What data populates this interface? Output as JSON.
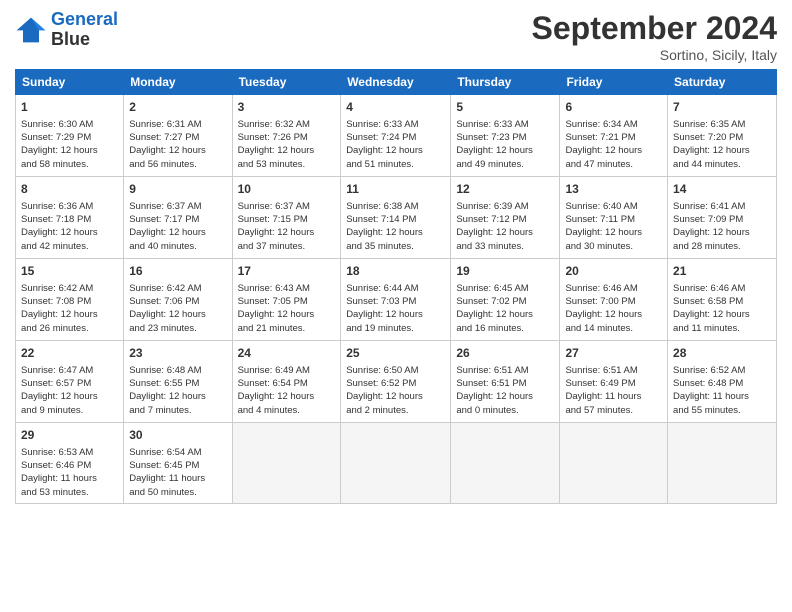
{
  "logo": {
    "line1": "General",
    "line2": "Blue"
  },
  "title": "September 2024",
  "location": "Sortino, Sicily, Italy",
  "days_of_week": [
    "Sunday",
    "Monday",
    "Tuesday",
    "Wednesday",
    "Thursday",
    "Friday",
    "Saturday"
  ],
  "weeks": [
    [
      {
        "num": "1",
        "info": "Sunrise: 6:30 AM\nSunset: 7:29 PM\nDaylight: 12 hours\nand 58 minutes."
      },
      {
        "num": "2",
        "info": "Sunrise: 6:31 AM\nSunset: 7:27 PM\nDaylight: 12 hours\nand 56 minutes."
      },
      {
        "num": "3",
        "info": "Sunrise: 6:32 AM\nSunset: 7:26 PM\nDaylight: 12 hours\nand 53 minutes."
      },
      {
        "num": "4",
        "info": "Sunrise: 6:33 AM\nSunset: 7:24 PM\nDaylight: 12 hours\nand 51 minutes."
      },
      {
        "num": "5",
        "info": "Sunrise: 6:33 AM\nSunset: 7:23 PM\nDaylight: 12 hours\nand 49 minutes."
      },
      {
        "num": "6",
        "info": "Sunrise: 6:34 AM\nSunset: 7:21 PM\nDaylight: 12 hours\nand 47 minutes."
      },
      {
        "num": "7",
        "info": "Sunrise: 6:35 AM\nSunset: 7:20 PM\nDaylight: 12 hours\nand 44 minutes."
      }
    ],
    [
      {
        "num": "8",
        "info": "Sunrise: 6:36 AM\nSunset: 7:18 PM\nDaylight: 12 hours\nand 42 minutes."
      },
      {
        "num": "9",
        "info": "Sunrise: 6:37 AM\nSunset: 7:17 PM\nDaylight: 12 hours\nand 40 minutes."
      },
      {
        "num": "10",
        "info": "Sunrise: 6:37 AM\nSunset: 7:15 PM\nDaylight: 12 hours\nand 37 minutes."
      },
      {
        "num": "11",
        "info": "Sunrise: 6:38 AM\nSunset: 7:14 PM\nDaylight: 12 hours\nand 35 minutes."
      },
      {
        "num": "12",
        "info": "Sunrise: 6:39 AM\nSunset: 7:12 PM\nDaylight: 12 hours\nand 33 minutes."
      },
      {
        "num": "13",
        "info": "Sunrise: 6:40 AM\nSunset: 7:11 PM\nDaylight: 12 hours\nand 30 minutes."
      },
      {
        "num": "14",
        "info": "Sunrise: 6:41 AM\nSunset: 7:09 PM\nDaylight: 12 hours\nand 28 minutes."
      }
    ],
    [
      {
        "num": "15",
        "info": "Sunrise: 6:42 AM\nSunset: 7:08 PM\nDaylight: 12 hours\nand 26 minutes."
      },
      {
        "num": "16",
        "info": "Sunrise: 6:42 AM\nSunset: 7:06 PM\nDaylight: 12 hours\nand 23 minutes."
      },
      {
        "num": "17",
        "info": "Sunrise: 6:43 AM\nSunset: 7:05 PM\nDaylight: 12 hours\nand 21 minutes."
      },
      {
        "num": "18",
        "info": "Sunrise: 6:44 AM\nSunset: 7:03 PM\nDaylight: 12 hours\nand 19 minutes."
      },
      {
        "num": "19",
        "info": "Sunrise: 6:45 AM\nSunset: 7:02 PM\nDaylight: 12 hours\nand 16 minutes."
      },
      {
        "num": "20",
        "info": "Sunrise: 6:46 AM\nSunset: 7:00 PM\nDaylight: 12 hours\nand 14 minutes."
      },
      {
        "num": "21",
        "info": "Sunrise: 6:46 AM\nSunset: 6:58 PM\nDaylight: 12 hours\nand 11 minutes."
      }
    ],
    [
      {
        "num": "22",
        "info": "Sunrise: 6:47 AM\nSunset: 6:57 PM\nDaylight: 12 hours\nand 9 minutes."
      },
      {
        "num": "23",
        "info": "Sunrise: 6:48 AM\nSunset: 6:55 PM\nDaylight: 12 hours\nand 7 minutes."
      },
      {
        "num": "24",
        "info": "Sunrise: 6:49 AM\nSunset: 6:54 PM\nDaylight: 12 hours\nand 4 minutes."
      },
      {
        "num": "25",
        "info": "Sunrise: 6:50 AM\nSunset: 6:52 PM\nDaylight: 12 hours\nand 2 minutes."
      },
      {
        "num": "26",
        "info": "Sunrise: 6:51 AM\nSunset: 6:51 PM\nDaylight: 12 hours\nand 0 minutes."
      },
      {
        "num": "27",
        "info": "Sunrise: 6:51 AM\nSunset: 6:49 PM\nDaylight: 11 hours\nand 57 minutes."
      },
      {
        "num": "28",
        "info": "Sunrise: 6:52 AM\nSunset: 6:48 PM\nDaylight: 11 hours\nand 55 minutes."
      }
    ],
    [
      {
        "num": "29",
        "info": "Sunrise: 6:53 AM\nSunset: 6:46 PM\nDaylight: 11 hours\nand 53 minutes."
      },
      {
        "num": "30",
        "info": "Sunrise: 6:54 AM\nSunset: 6:45 PM\nDaylight: 11 hours\nand 50 minutes."
      },
      null,
      null,
      null,
      null,
      null
    ]
  ]
}
